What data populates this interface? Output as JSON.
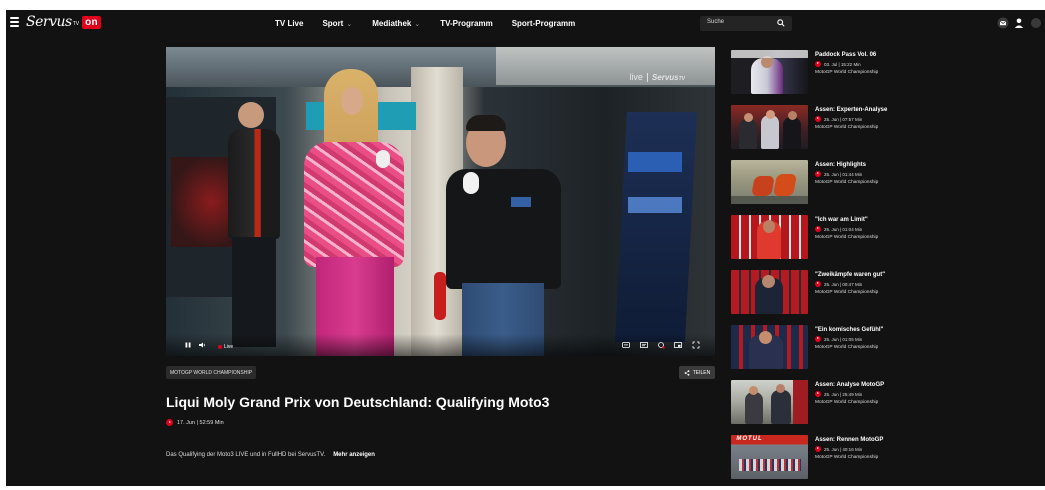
{
  "header": {
    "logo_script": "Servus",
    "logo_tv": "TV",
    "logo_on": "on",
    "nav": [
      {
        "label": "TV Live",
        "has_dropdown": false
      },
      {
        "label": "Sport",
        "has_dropdown": true
      },
      {
        "label": "Mediathek",
        "has_dropdown": true
      },
      {
        "label": "TV-Programm",
        "has_dropdown": false
      },
      {
        "label": "Sport-Programm",
        "has_dropdown": false
      }
    ],
    "search_placeholder": "Suche",
    "icons": [
      "menu-icon",
      "search-icon",
      "mail-icon",
      "user-icon"
    ]
  },
  "player": {
    "overlay_text": "live",
    "overlay_mark": "ServusTV",
    "live_label": "Live",
    "controls": [
      "pause-icon",
      "volume-icon",
      "subtitles-icon",
      "settings-icon",
      "chromecast-icon",
      "pip-icon",
      "fullscreen-icon"
    ]
  },
  "video": {
    "category": "MOTOGP WORLD CHAMPIONSHIP",
    "share_label": "TEILEN",
    "title": "Liqui Moly Grand Prix von Deutschland: Qualifying Moto3",
    "meta": "17. Jun | 52:59 Min",
    "description": "Das Qualifying der Moto3 LIVE und in FullHD bei ServusTV.",
    "more_label": "Mehr anzeigen"
  },
  "sidebar": {
    "items": [
      {
        "title": "Paddock Pass Vol. 06",
        "meta": "03. Jul | 15:22 Min",
        "category": "MotoGP World Championship"
      },
      {
        "title": "Assen: Experten-Analyse",
        "meta": "25. Jun | 07:57 Min",
        "category": "MotoGP World Championship"
      },
      {
        "title": "Assen: Highlights",
        "meta": "25. Jun | 01:44 Min",
        "category": "MotoGP World Championship"
      },
      {
        "title": "\"Ich war am Limit\"",
        "meta": "25. Jun | 01:04 Min",
        "category": "MotoGP World Championship"
      },
      {
        "title": "\"Zweikämpfe waren gut\"",
        "meta": "25. Jun | 00:47 Min",
        "category": "MotoGP World Championship"
      },
      {
        "title": "\"Ein komisches Gefühl\"",
        "meta": "25. Jun | 01:05 Min",
        "category": "MotoGP World Championship"
      },
      {
        "title": "Assen: Analyse MotoGP",
        "meta": "25. Jun | 25:49 Min",
        "category": "MotoGP World Championship"
      },
      {
        "title": "Assen: Rennen MotoGP",
        "meta": "25. Jun | 40:16 Min",
        "category": "MotoGP World Championship"
      }
    ]
  },
  "colors": {
    "background": "#121212",
    "accent": "#e0001b",
    "chip": "#2b2b2b"
  }
}
